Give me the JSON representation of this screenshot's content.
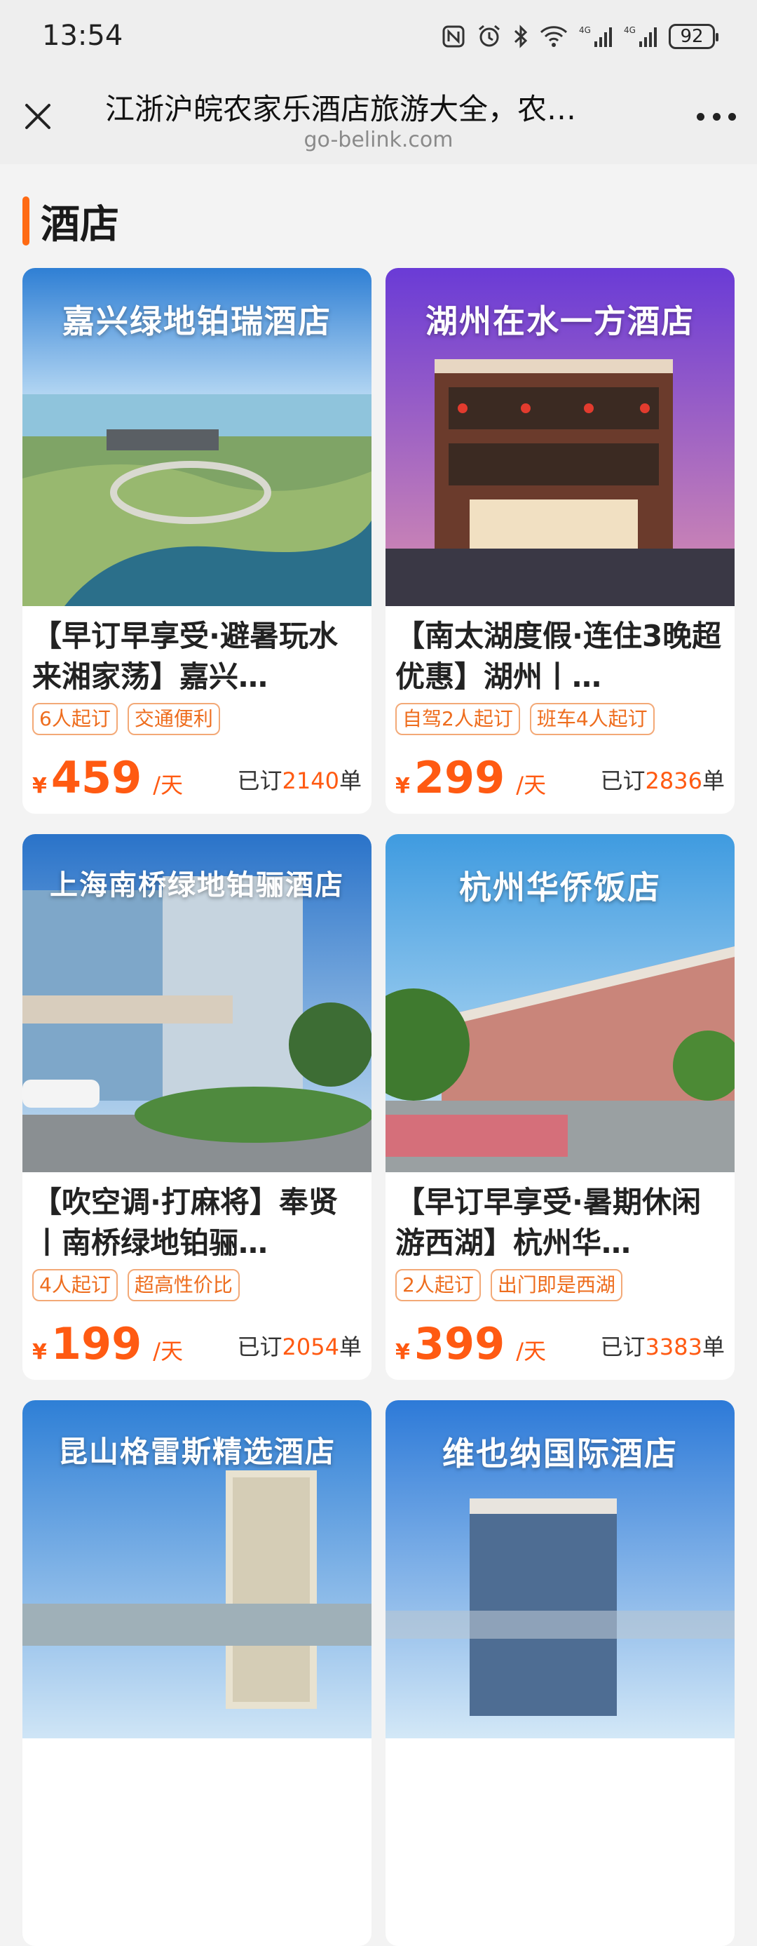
{
  "status_bar": {
    "time": "13:54",
    "battery": "92",
    "icons": [
      "nfc-icon",
      "alarm-icon",
      "bluetooth-icon",
      "wifi-icon",
      "signal-4g-icon",
      "signal-4g-icon"
    ]
  },
  "nav": {
    "title": "江浙沪皖农家乐酒店旅游大全，农…",
    "url": "go-belink.com"
  },
  "section": {
    "title": "酒店"
  },
  "cards": [
    {
      "caption": "嘉兴绿地铂瑞酒店",
      "title": "【早订早享受·避暑玩水来湘家荡】嘉兴…",
      "tags": [
        "6人起订",
        "交通便利"
      ],
      "yen": "¥",
      "price": "459",
      "unit": "/天",
      "sold_prefix": "已订",
      "sold_count": "2140",
      "sold_suffix": "单"
    },
    {
      "caption": "湖州在水一方酒店",
      "title": "【南太湖度假·连住3晚超优惠】湖州丨…",
      "tags": [
        "自驾2人起订",
        "班车4人起订"
      ],
      "yen": "¥",
      "price": "299",
      "unit": "/天",
      "sold_prefix": "已订",
      "sold_count": "2836",
      "sold_suffix": "单"
    },
    {
      "caption": "上海南桥绿地铂骊酒店",
      "title": "【吹空调·打麻将】奉贤丨南桥绿地铂骊…",
      "tags": [
        "4人起订",
        "超高性价比"
      ],
      "yen": "¥",
      "price": "199",
      "unit": "/天",
      "sold_prefix": "已订",
      "sold_count": "2054",
      "sold_suffix": "单"
    },
    {
      "caption": "杭州华侨饭店",
      "title": "【早订早享受·暑期休闲游西湖】杭州华…",
      "tags": [
        "2人起订",
        "出门即是西湖"
      ],
      "yen": "¥",
      "price": "399",
      "unit": "/天",
      "sold_prefix": "已订",
      "sold_count": "3383",
      "sold_suffix": "单"
    },
    {
      "caption": "昆山格雷斯精选酒店"
    },
    {
      "caption": "维也纳国际酒店"
    }
  ],
  "colors": {
    "accent": "#ff5a12",
    "tag_border": "#f3a977",
    "background": "#f3f3f3"
  }
}
